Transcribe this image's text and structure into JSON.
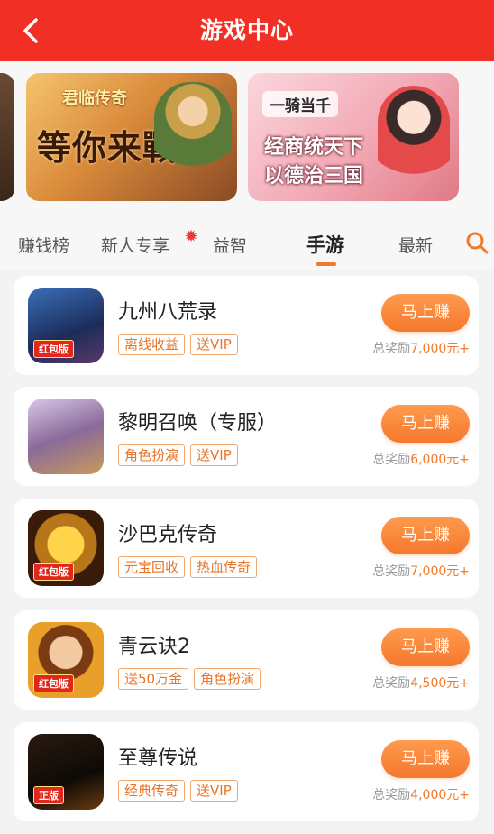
{
  "header": {
    "title": "游戏中心",
    "back_icon": "chevron-left-icon"
  },
  "banners": [
    {
      "logo": "",
      "slogan": ""
    },
    {
      "logo": "君临传奇",
      "slogan": "等你来戰"
    },
    {
      "logo": "一骑当千",
      "slogan_line1": "经商统天下",
      "slogan_line2": "以德治三国"
    }
  ],
  "tabs": [
    {
      "label": "赚钱榜",
      "active": false
    },
    {
      "label": "新人专享",
      "active": false
    },
    {
      "label": "益智",
      "active": false
    },
    {
      "label": "手游",
      "active": true
    },
    {
      "label": "最新",
      "active": false
    }
  ],
  "colors": {
    "header": "#f22f24",
    "accent": "#f5782c",
    "tag": "#e8742a"
  },
  "games": [
    {
      "name": "九州八荒录",
      "tags": [
        "离线收益",
        "送VIP"
      ],
      "button": "马上赚",
      "reward_prefix": "总奖励",
      "reward_value": "7,000元+",
      "badge": "红包版"
    },
    {
      "name": "黎明召唤（专服）",
      "tags": [
        "角色扮演",
        "送VIP"
      ],
      "button": "马上赚",
      "reward_prefix": "总奖励",
      "reward_value": "6,000元+",
      "badge": ""
    },
    {
      "name": "沙巴克传奇",
      "tags": [
        "元宝回收",
        "热血传奇"
      ],
      "button": "马上赚",
      "reward_prefix": "总奖励",
      "reward_value": "7,000元+",
      "badge": "红包版"
    },
    {
      "name": "青云诀2",
      "tags": [
        "送50万金",
        "角色扮演"
      ],
      "button": "马上赚",
      "reward_prefix": "总奖励",
      "reward_value": "4,500元+",
      "badge": "红包版"
    },
    {
      "name": "至尊传说",
      "tags": [
        "经典传奇",
        "送VIP"
      ],
      "button": "马上赚",
      "reward_prefix": "总奖励",
      "reward_value": "4,000元+",
      "badge": "正版"
    }
  ]
}
